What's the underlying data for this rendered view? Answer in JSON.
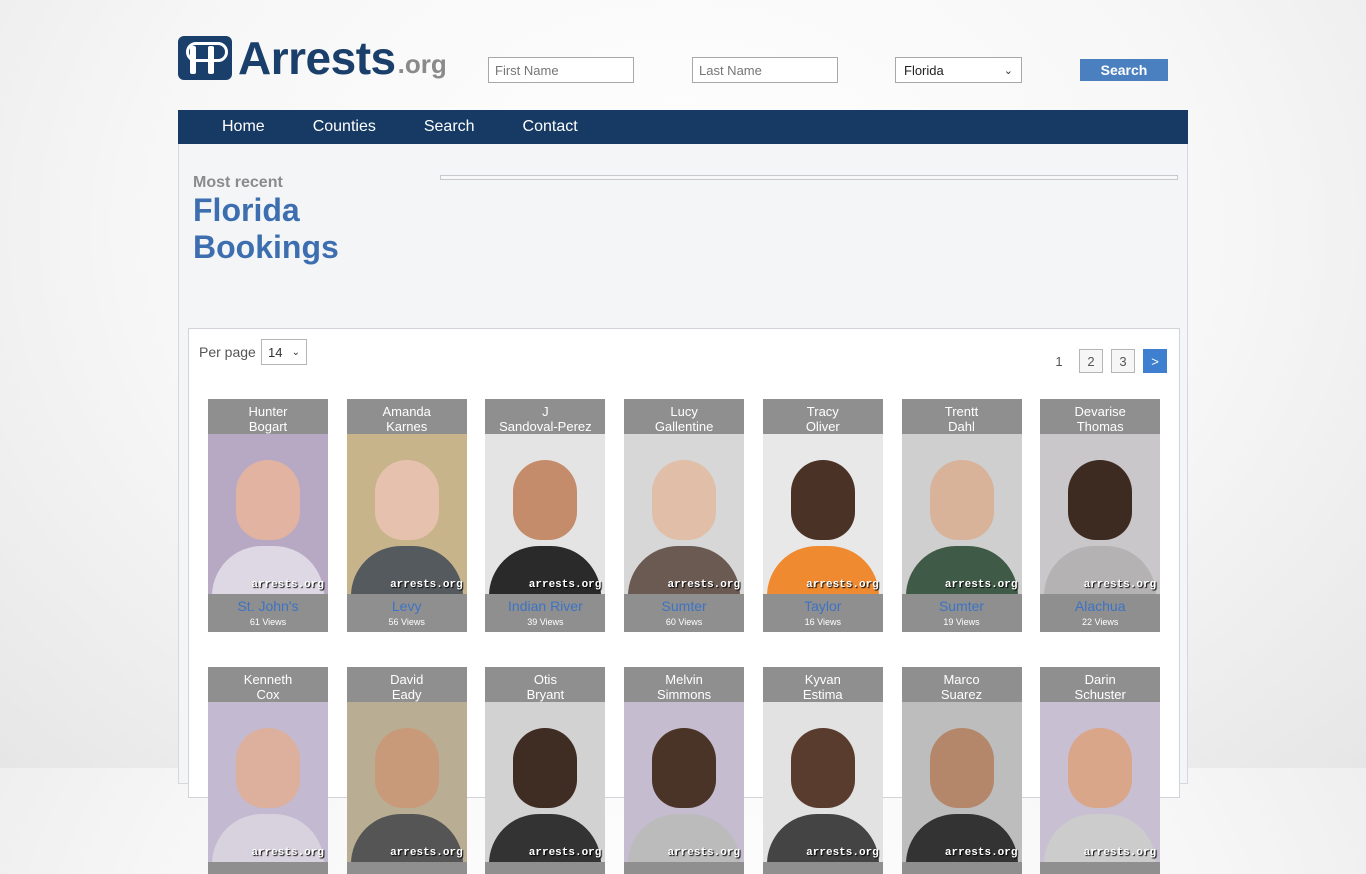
{
  "site": {
    "logo_text": "Arrests",
    "logo_tld": ".org"
  },
  "search": {
    "first_name_placeholder": "First Name",
    "last_name_placeholder": "Last Name",
    "state_selected": "Florida",
    "button_label": "Search"
  },
  "nav": {
    "items": [
      "Home",
      "Counties",
      "Search",
      "Contact"
    ]
  },
  "header": {
    "subtitle": "Most recent",
    "title_line1": "Florida",
    "title_line2": "Bookings"
  },
  "listing": {
    "per_page_label": "Per page",
    "per_page_value": "14",
    "pages": [
      "1",
      "2",
      "3",
      ">"
    ],
    "watermark": "arrests.org",
    "cards": [
      {
        "first": "Hunter",
        "last": "Bogart",
        "county": "St. John's",
        "views": "61 Views",
        "bg": "#b7a9c4",
        "skin": "#e2b3a0",
        "body": "#ded8e4"
      },
      {
        "first": "Amanda",
        "last": "Karnes",
        "county": "Levy",
        "views": "56 Views",
        "bg": "#c8b48a",
        "skin": "#e6c2ae",
        "body": "#555a5e"
      },
      {
        "first": "J",
        "last": "Sandoval-Perez",
        "county": "Indian River",
        "views": "39 Views",
        "bg": "#e4e4e4",
        "skin": "#c48c6a",
        "body": "#2a2a2a"
      },
      {
        "first": "Lucy",
        "last": "Gallentine",
        "county": "Sumter",
        "views": "60 Views",
        "bg": "#d7d7d7",
        "skin": "#e1bea8",
        "body": "#6a5a52"
      },
      {
        "first": "Tracy",
        "last": "Oliver",
        "county": "Taylor",
        "views": "16 Views",
        "bg": "#e8e8e8",
        "skin": "#4a3326",
        "body": "#f08a30"
      },
      {
        "first": "Trentt",
        "last": "Dahl",
        "county": "Sumter",
        "views": "19 Views",
        "bg": "#cfcfd0",
        "skin": "#d9b29a",
        "body": "#3f5a46"
      },
      {
        "first": "Devarise",
        "last": "Thomas",
        "county": "Alachua",
        "views": "22 Views",
        "bg": "#c9c7c9",
        "skin": "#3d2a20",
        "body": "#b4b2b3"
      },
      {
        "first": "Kenneth",
        "last": "Cox",
        "county": "",
        "views": "",
        "bg": "#c3b9d0",
        "skin": "#dcb09c",
        "body": "#d8d2de"
      },
      {
        "first": "David",
        "last": "Eady",
        "county": "",
        "views": "",
        "bg": "#b9ad93",
        "skin": "#c99a7a",
        "body": "#555"
      },
      {
        "first": "Otis",
        "last": "Bryant",
        "county": "",
        "views": "",
        "bg": "#d2d2d2",
        "skin": "#3f2c22",
        "body": "#333"
      },
      {
        "first": "Melvin",
        "last": "Simmons",
        "county": "",
        "views": "",
        "bg": "#c5bccf",
        "skin": "#4a3428",
        "body": "#bbb"
      },
      {
        "first": "Kyvan",
        "last": "Estima",
        "county": "",
        "views": "",
        "bg": "#e2e2e2",
        "skin": "#5a3c2e",
        "body": "#444"
      },
      {
        "first": "Marco",
        "last": "Suarez",
        "county": "",
        "views": "",
        "bg": "#bdbdbd",
        "skin": "#b5876a",
        "body": "#333"
      },
      {
        "first": "Darin",
        "last": "Schuster",
        "county": "",
        "views": "",
        "bg": "#c8c0d2",
        "skin": "#d9a68a",
        "body": "#ccc"
      }
    ]
  }
}
